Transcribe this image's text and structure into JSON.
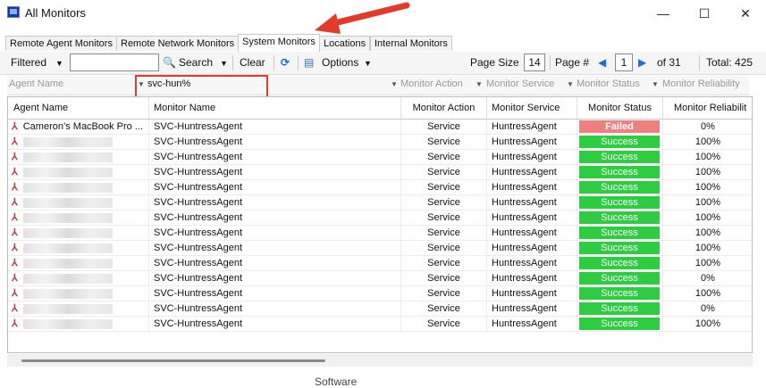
{
  "window": {
    "title": "All Monitors",
    "minimize": "—",
    "maximize": "☐",
    "close": "✕"
  },
  "tabs": [
    {
      "label": "Remote Agent Monitors"
    },
    {
      "label": "Remote Network Monitors"
    },
    {
      "label": "System Monitors"
    },
    {
      "label": "Locations"
    },
    {
      "label": "Internal Monitors"
    }
  ],
  "toolbar": {
    "filtered": "Filtered",
    "search": "Search",
    "clear": "Clear",
    "options": "Options",
    "page_size_label": "Page Size",
    "page_size": "14",
    "page_label": "Page #",
    "page": "1",
    "of_pages": "of 31",
    "total": "Total: 425"
  },
  "filters": {
    "agent_name": "Agent Name",
    "monitor_name_value": "svc-hun%",
    "monitor_action": "Monitor Action",
    "monitor_service": "Monitor Service",
    "monitor_status": "Monitor Status",
    "monitor_reliability": "Monitor Reliability"
  },
  "columns": [
    "Agent Name",
    "Monitor Name",
    "Monitor Action",
    "Monitor Service",
    "Monitor Status",
    "Monitor Reliabilit"
  ],
  "rows": [
    {
      "agent": "Cameron’s MacBook Pro ...",
      "monitor": "SVC-HuntressAgent",
      "action": "Service",
      "service": "HuntressAgent",
      "status": "Failed",
      "reliability": "0%"
    },
    {
      "agent": "",
      "monitor": "SVC-HuntressAgent",
      "action": "Service",
      "service": "HuntressAgent",
      "status": "Success",
      "reliability": "100%"
    },
    {
      "agent": "",
      "monitor": "SVC-HuntressAgent",
      "action": "Service",
      "service": "HuntressAgent",
      "status": "Success",
      "reliability": "100%"
    },
    {
      "agent": "",
      "monitor": "SVC-HuntressAgent",
      "action": "Service",
      "service": "HuntressAgent",
      "status": "Success",
      "reliability": "100%"
    },
    {
      "agent": "",
      "monitor": "SVC-HuntressAgent",
      "action": "Service",
      "service": "HuntressAgent",
      "status": "Success",
      "reliability": "100%"
    },
    {
      "agent": "",
      "monitor": "SVC-HuntressAgent",
      "action": "Service",
      "service": "HuntressAgent",
      "status": "Success",
      "reliability": "100%"
    },
    {
      "agent": "",
      "monitor": "SVC-HuntressAgent",
      "action": "Service",
      "service": "HuntressAgent",
      "status": "Success",
      "reliability": "100%"
    },
    {
      "agent": "",
      "monitor": "SVC-HuntressAgent",
      "action": "Service",
      "service": "HuntressAgent",
      "status": "Success",
      "reliability": "100%"
    },
    {
      "agent": "",
      "monitor": "SVC-HuntressAgent",
      "action": "Service",
      "service": "HuntressAgent",
      "status": "Success",
      "reliability": "100%"
    },
    {
      "agent": "",
      "monitor": "SVC-HuntressAgent",
      "action": "Service",
      "service": "HuntressAgent",
      "status": "Success",
      "reliability": "100%"
    },
    {
      "agent": "",
      "monitor": "SVC-HuntressAgent",
      "action": "Service",
      "service": "HuntressAgent",
      "status": "Success",
      "reliability": "0%"
    },
    {
      "agent": "",
      "monitor": "SVC-HuntressAgent",
      "action": "Service",
      "service": "HuntressAgent",
      "status": "Success",
      "reliability": "100%"
    },
    {
      "agent": "",
      "monitor": "SVC-HuntressAgent",
      "action": "Service",
      "service": "HuntressAgent",
      "status": "Success",
      "reliability": "0%"
    },
    {
      "agent": "",
      "monitor": "SVC-HuntressAgent",
      "action": "Service",
      "service": "HuntressAgent",
      "status": "Success",
      "reliability": "100%"
    }
  ],
  "colors": {
    "failed": "#f07f7f",
    "success": "#2ecc40",
    "annotation": "#e23b2a"
  },
  "footer": {
    "text": "Software"
  }
}
